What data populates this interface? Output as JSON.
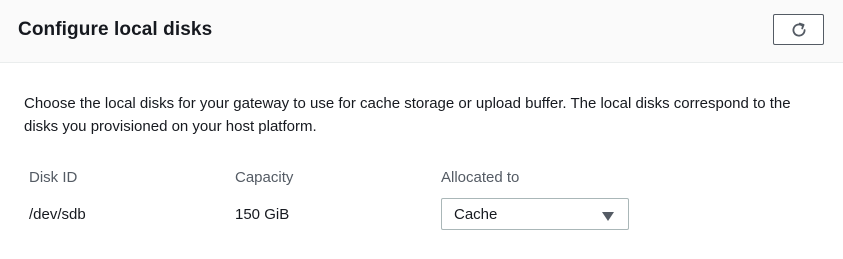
{
  "header": {
    "title": "Configure local disks",
    "refresh_icon": "refresh-icon"
  },
  "description": "Choose the local disks for your gateway to use for cache storage or upload buffer. The local disks correspond to the disks you provisioned on your host platform.",
  "table": {
    "columns": [
      "Disk ID",
      "Capacity",
      "Allocated to"
    ],
    "rows": [
      {
        "disk_id": "/dev/sdb",
        "capacity": "150 GiB",
        "allocated_to": "Cache"
      }
    ]
  },
  "colors": {
    "header_background": "#fafafa",
    "text": "#16191f",
    "muted_text": "#545b64",
    "border": "#aab7b8"
  }
}
